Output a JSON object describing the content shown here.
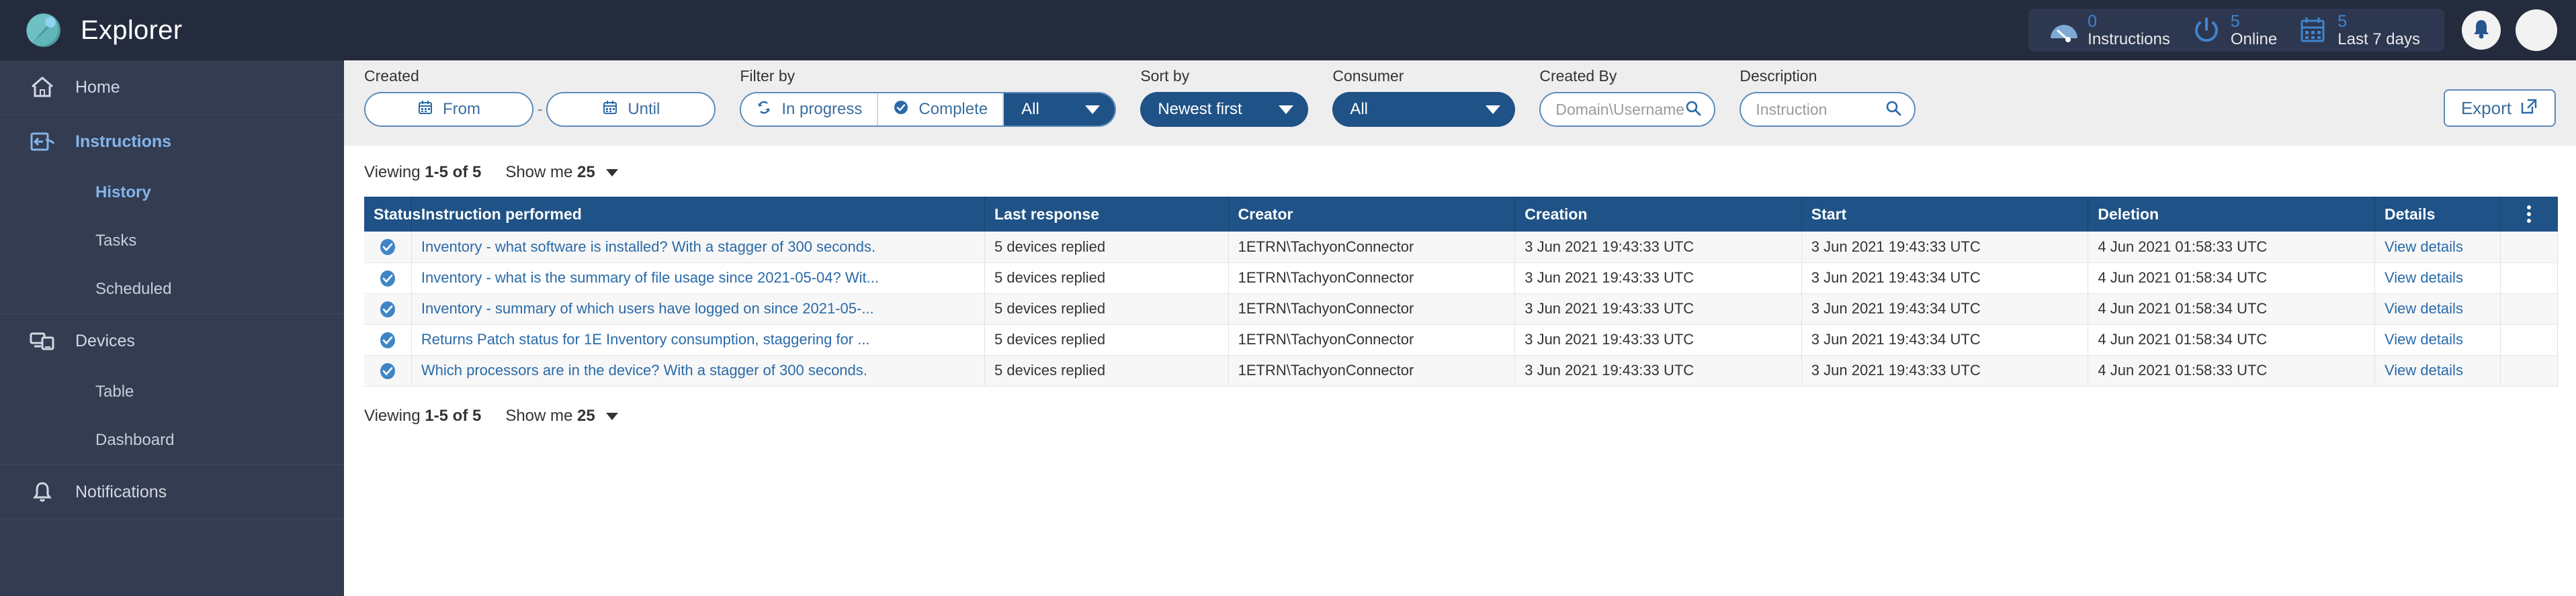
{
  "app": {
    "title": "Explorer",
    "logo_icon": "explorer-logo-icon"
  },
  "header": {
    "stats": [
      {
        "icon": "gauge-icon",
        "value": "0",
        "label": "Instructions"
      },
      {
        "icon": "power-icon",
        "value": "5",
        "label": "Online"
      },
      {
        "icon": "calendar-icon",
        "value": "5",
        "label": "Last 7 days"
      }
    ],
    "notifications_icon": "bell-icon",
    "avatar_icon": "avatar"
  },
  "sidebar": {
    "groups": [
      {
        "items": [
          {
            "label": "Home",
            "icon": "home-icon",
            "active": false
          }
        ]
      },
      {
        "items": [
          {
            "label": "Instructions",
            "icon": "instructions-icon",
            "active": true
          }
        ],
        "subitems": [
          {
            "label": "History",
            "active": true
          },
          {
            "label": "Tasks",
            "active": false
          },
          {
            "label": "Scheduled",
            "active": false
          }
        ]
      },
      {
        "items": [
          {
            "label": "Devices",
            "icon": "devices-icon",
            "active": false
          }
        ],
        "subitems": [
          {
            "label": "Table",
            "active": false
          },
          {
            "label": "Dashboard",
            "active": false
          }
        ]
      },
      {
        "items": [
          {
            "label": "Notifications",
            "icon": "bell-icon",
            "active": false
          }
        ]
      }
    ]
  },
  "filters": {
    "created": {
      "label": "Created",
      "from_label": "From",
      "until_label": "Until",
      "separator": "-",
      "calendar_icon": "calendar-icon"
    },
    "filter_by": {
      "label": "Filter by",
      "in_progress_label": "In progress",
      "in_progress_icon": "refresh-icon",
      "complete_label": "Complete",
      "complete_icon": "check-circle-icon",
      "dropdown_value": "All"
    },
    "sort_by": {
      "label": "Sort by",
      "value": "Newest first"
    },
    "consumer": {
      "label": "Consumer",
      "value": "All"
    },
    "created_by": {
      "label": "Created By",
      "value": "",
      "placeholder": "Domain\\Username",
      "search_icon": "search-icon"
    },
    "description": {
      "label": "Description",
      "value": "",
      "placeholder": "Instruction",
      "search_icon": "search-icon"
    },
    "export": {
      "label": "Export",
      "icon": "external-link-icon"
    }
  },
  "pagination": {
    "viewing_prefix": "Viewing",
    "viewing_range": "1-5 of 5",
    "show_me_label": "Show me",
    "show_me_value": "25"
  },
  "table": {
    "columns": [
      "Status",
      "Instruction performed",
      "Last response",
      "Creator",
      "Creation",
      "Start",
      "Deletion",
      "Details",
      ""
    ],
    "kebab_icon": "more-vertical-icon",
    "status_icon": "check-circle-icon",
    "rows": [
      {
        "status": "complete",
        "instruction": "Inventory - what software is installed? With a stagger of 300 seconds.",
        "last_response": "5 devices replied",
        "creator": "1ETRN\\TachyonConnector",
        "creation": "3 Jun 2021 19:43:33 UTC",
        "start": "3 Jun 2021 19:43:33 UTC",
        "deletion": "4 Jun 2021 01:58:33 UTC",
        "details": "View details"
      },
      {
        "status": "complete",
        "instruction": "Inventory - what is the summary of file usage since 2021-05-04? Wit...",
        "last_response": "5 devices replied",
        "creator": "1ETRN\\TachyonConnector",
        "creation": "3 Jun 2021 19:43:33 UTC",
        "start": "3 Jun 2021 19:43:34 UTC",
        "deletion": "4 Jun 2021 01:58:34 UTC",
        "details": "View details"
      },
      {
        "status": "complete",
        "instruction": "Inventory - summary of which users have logged on since 2021-05-...",
        "last_response": "5 devices replied",
        "creator": "1ETRN\\TachyonConnector",
        "creation": "3 Jun 2021 19:43:33 UTC",
        "start": "3 Jun 2021 19:43:34 UTC",
        "deletion": "4 Jun 2021 01:58:34 UTC",
        "details": "View details"
      },
      {
        "status": "complete",
        "instruction": "Returns Patch status for 1E Inventory consumption, staggering for ...",
        "last_response": "5 devices replied",
        "creator": "1ETRN\\TachyonConnector",
        "creation": "3 Jun 2021 19:43:33 UTC",
        "start": "3 Jun 2021 19:43:34 UTC",
        "deletion": "4 Jun 2021 01:58:34 UTC",
        "details": "View details"
      },
      {
        "status": "complete",
        "instruction": "Which processors are in the device? With a stagger of 300 seconds.",
        "last_response": "5 devices replied",
        "creator": "1ETRN\\TachyonConnector",
        "creation": "3 Jun 2021 19:43:33 UTC",
        "start": "3 Jun 2021 19:43:33 UTC",
        "deletion": "4 Jun 2021 01:58:33 UTC",
        "details": "View details"
      }
    ]
  },
  "colors": {
    "topbar_bg": "#242b3d",
    "sidebar_bg": "#333c51",
    "accent_blue": "#1f5286",
    "link_blue": "#2a6aa8",
    "active_nav": "#84b4ea",
    "filter_bg": "#eeeeee"
  }
}
